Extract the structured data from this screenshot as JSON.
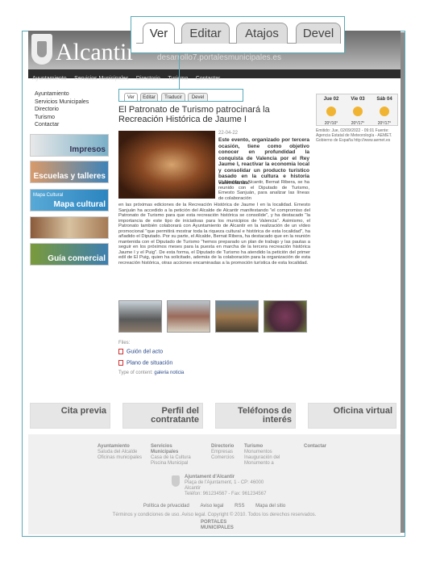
{
  "header": {
    "logo": "Alcantir",
    "domain": "desarrollo7.portalesmunicipales.es"
  },
  "topnav": [
    "Ayuntamiento",
    "Servicios Municipales",
    "Directorio",
    "Turismo",
    "Contactar"
  ],
  "bigtabs": [
    "Ver",
    "Editar",
    "Atajos",
    "Devel"
  ],
  "smalltabs": [
    "Ver",
    "Editar",
    "Traducir",
    "Devel"
  ],
  "leftnav": [
    "Ayuntamiento",
    "Servicios Municipales",
    "Directorio",
    "Turismo",
    "Contactar"
  ],
  "banners": [
    {
      "label": "Impresos",
      "sub": ""
    },
    {
      "label": "Escuelas y talleres",
      "sub": ""
    },
    {
      "label": "Mapa cultural",
      "sub": "Mapa Cultural"
    },
    {
      "label": "",
      "sub": ""
    },
    {
      "label": "Guía comercial",
      "sub": ""
    }
  ],
  "article": {
    "title": "El Patronato de Turismo patrocinará la Recreación Histórica de Jaume I",
    "date": "22-04-22",
    "lead": "Este evento, organizado por tercera ocasión, tiene como objetivo conocer en profundidad la conquista de Valencia por el Rey Jaume I, reactivar la economía local y consolidar un producto turístico basado en la cultura e historia valencianas.",
    "body1": "El Alcalde de Alcantir, Bernat Ribera, se ha reunido con el Diputado de Turismo, Ernesto Sanjuán, para analizar las líneas de colaboración",
    "body2": "en las próximas ediciones de la Recreación Histórica de Jaume I en la localidad. Ernesto Sanjuán ha accedido a la petición del Alcalde de Alcantir manifestando \"el compromiso del Patronato de Turismo para que esta recreación histórica se consolide\", y ha destacado \"la importancia de este tipo de iniciativas para los municipios de Valencia\". Asimismo, el Patronato también colaborará con Ayuntamiento de Alcantir en la realización de un vídeo promocional \"que permitirá mostrar toda la riqueza cultural e histórica de esta localidad\", ha añadido el Diputado. Por su parte, el Alcalde, Bernat Ribera, ha destacado que en la reunión mantenida con el Diputado de Turismo \"hemos preparado un plan de trabajo y las pautas a seguir en los próximos meses para la puesta en marcha de la tercera recreación histórica Jaume I y el Puig\". De esta forma, el Diputado de Turismo ha atendido la petición del primer edil de El Puig, quien ha solicitado, además de la colaboración para la organización de esta recreación histórica, otras acciones encaminadas a la promoción turística de esta localidad."
  },
  "files_label": "Files:",
  "files": [
    "Guión del acto",
    "Plano de situación"
  ],
  "type_content": {
    "label": "Type of content:",
    "values": "galeria  noticia"
  },
  "weather": {
    "days": [
      {
        "day": "Jue 02",
        "temp": "20°/10°"
      },
      {
        "day": "Vie 03",
        "temp": "20°/17°"
      },
      {
        "day": "Sáb 04",
        "temp": "20°/17°"
      }
    ],
    "source": "Emitido: Jue, 02/09/2022 - 09:01 Fuente: Agencia Estatal de Meteorología - AEMET. Gobierno de España http://www.aemet.es"
  },
  "bottom_banners": [
    "Cita previa",
    "Perfil del contratante",
    "Teléfonos de interés",
    "Oficina virtual"
  ],
  "footer": {
    "cols": [
      {
        "title": "Ayuntamiento",
        "items": [
          "Saluda del Alcalde",
          "Oficinas municipales"
        ]
      },
      {
        "title": "Servicios Municipales",
        "items": [
          "Casa de la Cultura",
          "Piscina Municipal"
        ]
      },
      {
        "title": "Directorio",
        "items": [
          "Empresas",
          "Comercios"
        ]
      },
      {
        "title": "Turismo",
        "items": [
          "Monumentos",
          "Inauguración del Monumento a"
        ]
      },
      {
        "title": "Contactar",
        "items": []
      }
    ],
    "address": {
      "name": "Ajuntament d'Alcantir",
      "line1": "Plaça de l'Ajuntament, 1 - CP: 46000",
      "line2": "Alcantir",
      "line3": "Teléfon: 961234567 - Fax: 961234567"
    },
    "links": [
      "Política de privacidad",
      "Aviso legal",
      "RSS",
      "Mapa del sitio"
    ],
    "copyright": "Términos y condiciones de uso. Aviso legal. Copyright © 2010. Todos los derechos reservados.",
    "portales": "PORTALES MUNICIPALES"
  }
}
